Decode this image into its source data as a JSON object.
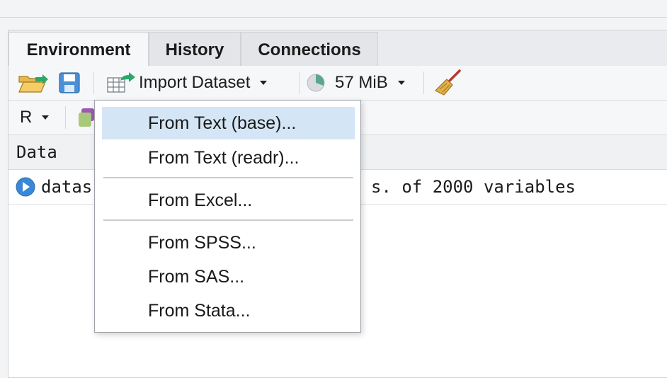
{
  "tabs": [
    {
      "label": "Environment",
      "active": true
    },
    {
      "label": "History",
      "active": false
    },
    {
      "label": "Connections",
      "active": false
    }
  ],
  "toolbar": {
    "import_label": "Import Dataset",
    "memory_label": "57 MiB"
  },
  "toolbar2": {
    "language_label": "R"
  },
  "data_header": "Data",
  "data_row": {
    "name_visible": "datas",
    "desc_visible": "s. of 2000 variables"
  },
  "menu": {
    "items": [
      {
        "label": "From Text (base)...",
        "highlighted": true
      },
      {
        "label": "From Text (readr)..."
      },
      {
        "label": "From Excel..."
      },
      {
        "label": "From SPSS..."
      },
      {
        "label": "From SAS..."
      },
      {
        "label": "From Stata..."
      }
    ]
  },
  "colors": {
    "highlight": "#d4e5f5",
    "pie_fill": "#5aa58f",
    "play_blue": "#3a87d8",
    "arrow_green": "#2aa86a"
  }
}
